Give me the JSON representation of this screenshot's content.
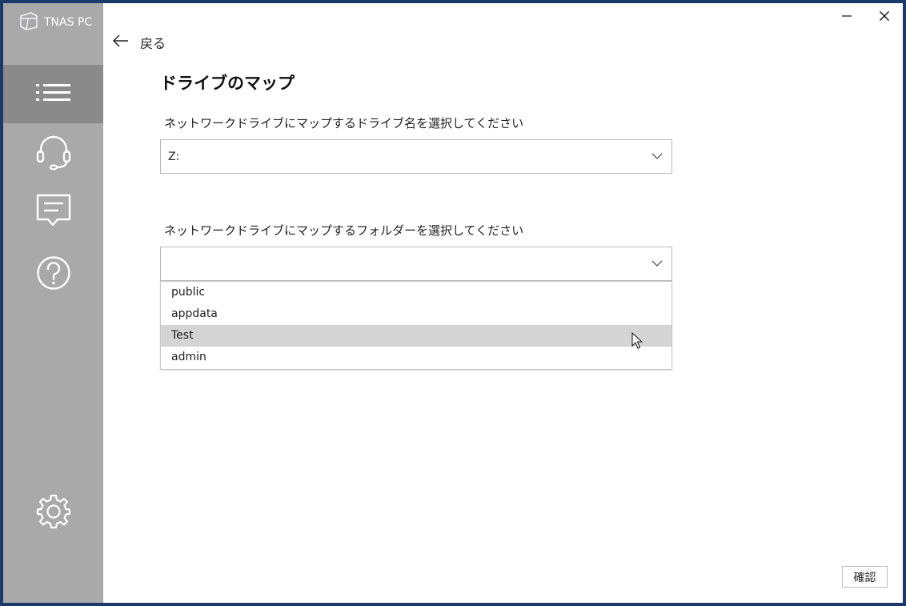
{
  "app": {
    "brand": "TNAS PC"
  },
  "sidebar": {
    "items": [
      {
        "icon": "list-icon",
        "active": true
      },
      {
        "icon": "headset-icon",
        "active": false
      },
      {
        "icon": "message-icon",
        "active": false
      },
      {
        "icon": "help-icon",
        "active": false
      },
      {
        "icon": "gear-icon",
        "active": false
      }
    ]
  },
  "window_controls": {
    "minimize": "minimize-icon",
    "close": "close-icon"
  },
  "header": {
    "back_label": "戻る"
  },
  "page": {
    "title": "ドライブのマップ",
    "drive_label": "ネットワークドライブにマップするドライブ名を選択してください",
    "drive_value": "Z:",
    "folder_label": "ネットワークドライブにマップするフォルダーを選択してください",
    "folder_value": "",
    "folder_options": [
      "public",
      "appdata",
      "Test",
      "admin"
    ],
    "hovered_option": "Test"
  },
  "footer": {
    "confirm_label": "確認"
  },
  "colors": {
    "sidebar_bg": "#a9a9a9",
    "sidebar_active": "#8a8a8a",
    "hover_bg": "#d4d4d4",
    "desktop_bg": "#1b3a6b"
  }
}
